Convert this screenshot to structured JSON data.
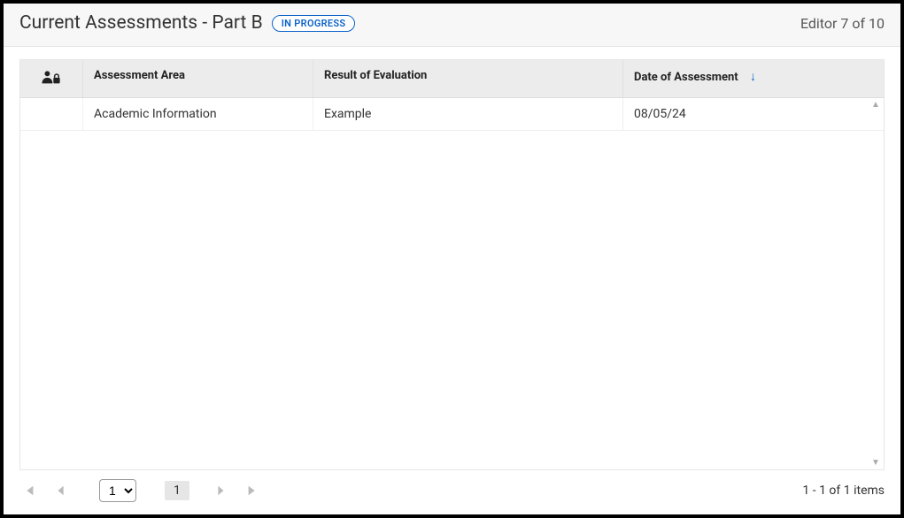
{
  "header": {
    "title": "Current Assessments - Part B",
    "status_badge": "IN PROGRESS",
    "editor_count": "Editor 7 of 10"
  },
  "table": {
    "columns": {
      "lock": "",
      "area": "Assessment Area",
      "result": "Result of Evaluation",
      "date": "Date of Assessment"
    },
    "sort": {
      "column": "date",
      "direction": "asc"
    },
    "rows": [
      {
        "lock": "",
        "area": "Academic Information",
        "result": "Example",
        "date": "08/05/24"
      }
    ]
  },
  "pager": {
    "page_select_value": "1",
    "page_select_options": [
      "1"
    ],
    "current_page": "1",
    "summary": "1 - 1 of 1 items"
  }
}
